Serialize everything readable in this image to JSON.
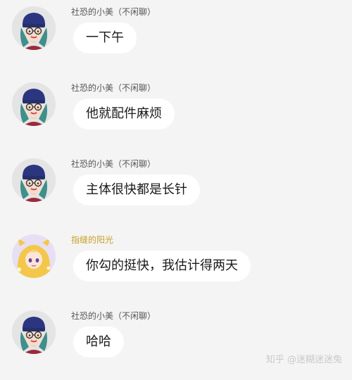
{
  "messages": [
    {
      "sender": "社恐的小美（不闲聊）",
      "text": "一下午",
      "avatar": "girl-beanie-avatar"
    },
    {
      "sender": "社恐的小美（不闲聊）",
      "text": "他就配件麻烦",
      "avatar": "girl-beanie-avatar"
    },
    {
      "sender": "社恐的小美（不闲聊）",
      "text": "主体很快都是长针",
      "avatar": "girl-beanie-avatar"
    },
    {
      "sender": "指缝的阳光",
      "text": "你勾的挺快，我估计得两天",
      "avatar": "anime-girl-avatar"
    },
    {
      "sender": "社恐的小美（不闲聊）",
      "text": "哈哈",
      "avatar": "girl-beanie-avatar"
    }
  ],
  "colors": {
    "background": "#f4f4f4",
    "bubble": "#ffffff",
    "sender_default": "#555555",
    "sender_highlight": "#c9a12a"
  },
  "watermark": "知乎 @迷糊迷迷兔"
}
